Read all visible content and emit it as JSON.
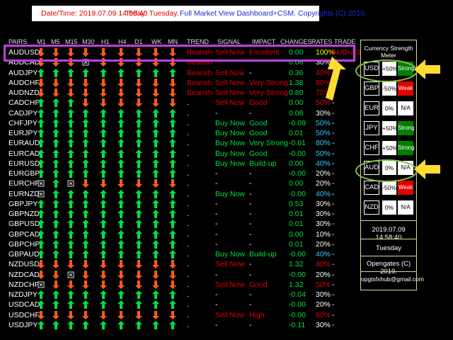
{
  "title_bar": {
    "datetime": "Date/Time:  2019.07.09 14:58:40",
    "today": "Today: Tuesday.",
    "dashboard": "Full Market View Dashboard+CSM. Copyrights (C) 2019."
  },
  "headers": [
    "PAIRS",
    "M1",
    "M5",
    "M15",
    "M30",
    "H1",
    "H4",
    "D1",
    "WK",
    "MN",
    "TREND",
    "SIGNAL",
    "IMPACT",
    "CHANGES",
    "RATES",
    "TRADE"
  ],
  "colors": {
    "up": "#00e040",
    "down": "#ff5a1a",
    "red": "#e00000",
    "green": "#00e040",
    "cyan": "#30d0ff",
    "yellow": "#ffff00",
    "white": "#ffffff",
    "strong_bg": "#008000",
    "weak_bg": "#e00000",
    "selection": "#c040e0",
    "callout_circle": "#80c040",
    "callout_arrow": "#ffdd30"
  },
  "rows": [
    {
      "pair": "AUDUSD",
      "arrows": "DDDDDDDDD",
      "trend": "Bearish",
      "signal": "Sell Now",
      "impact": "Excellent",
      "change": "0.00",
      "rate": "100%",
      "trade": "AUDUSD"
    },
    {
      "pair": "AUDCAD",
      "arrows": "DDDxDDDDD",
      "trend": "Bearish",
      "signal": "",
      "impact": "",
      "change": "0.06",
      "rate": "30%",
      "trade": "-"
    },
    {
      "pair": "AUDJPY",
      "arrows": "UUUUUUUUU",
      "trend": "Bearish",
      "signal": "Sell Now",
      "impact": "-",
      "change": "0.36",
      "rate": "40%",
      "trade": "-"
    },
    {
      "pair": "AUDCHF",
      "arrows": "DDDDDDDDD",
      "trend": "Bearish",
      "signal": "Sell Now",
      "impact": "Very Strong",
      "change": "1.38",
      "rate": "80%",
      "trade": "-"
    },
    {
      "pair": "AUDNZD",
      "arrows": "DDDDDDDDD",
      "trend": "Bearish",
      "signal": "Sell Now",
      "impact": "Very Strong",
      "change": "0.80",
      "rate": "70%",
      "trade": "-"
    },
    {
      "pair": "CADCHF",
      "arrows": "UUUDDDDDD",
      "trend": ".",
      "signal": "Sell Now",
      "impact": "Good",
      "change": "0.00",
      "rate": "50%",
      "trade": "-"
    },
    {
      "pair": "CADJPY",
      "arrows": "UUUUUUUUU",
      "trend": ".",
      "signal": "-",
      "impact": "-",
      "change": "0.08",
      "rate": "30%",
      "trade": "-"
    },
    {
      "pair": "CHFJPY",
      "arrows": "UUUUUUUUU",
      "trend": ".",
      "signal": "Buy Now",
      "impact": "Good",
      "change": "-0.09",
      "rate": "50%",
      "trade": "-"
    },
    {
      "pair": "EURJPY",
      "arrows": "UUUUUUUUU",
      "trend": ".",
      "signal": "Buy Now",
      "impact": "Good",
      "change": "0.01",
      "rate": "50%",
      "trade": "-"
    },
    {
      "pair": "EURAUD",
      "arrows": "UUUUUUUUU",
      "trend": ".",
      "signal": "Buy Now",
      "impact": "Very Strong",
      "change": "-0.01",
      "rate": "80%",
      "trade": "-"
    },
    {
      "pair": "EURCAD",
      "arrows": "UUUUUUUUU",
      "trend": ".",
      "signal": "Buy Now",
      "impact": "Good",
      "change": "-0.00",
      "rate": "50%",
      "trade": "-"
    },
    {
      "pair": "EURUSD",
      "arrows": "UUUUUUUUU",
      "trend": ".",
      "signal": "Buy Now",
      "impact": "Build-up",
      "change": "0.00",
      "rate": "40%",
      "trade": "-"
    },
    {
      "pair": "EURGBP",
      "arrows": "UUUUUUUUU",
      "trend": ".",
      "signal": "-",
      "impact": "-",
      "change": "-0.00",
      "rate": "20%",
      "trade": "-"
    },
    {
      "pair": "EURCHF",
      "arrows": "xUxDDDDDD",
      "trend": ".",
      "signal": "-",
      "impact": "-",
      "change": "0.00",
      "rate": "20%",
      "trade": "-"
    },
    {
      "pair": "EURNZD",
      "arrows": "xUUUUUUUU",
      "trend": ".",
      "signal": "Buy Now",
      "impact": "-",
      "change": "-0.00",
      "rate": "40%",
      "trade": "-"
    },
    {
      "pair": "GBPJPY",
      "arrows": "UUUUUUUUU",
      "trend": ".",
      "signal": "-",
      "impact": "-",
      "change": "0.53",
      "rate": "30%",
      "trade": "-"
    },
    {
      "pair": "GBPNZD",
      "arrows": "UUUUUUUUU",
      "trend": ".",
      "signal": "-",
      "impact": "-",
      "change": "0.01",
      "rate": "30%",
      "trade": "-"
    },
    {
      "pair": "GBPUSD",
      "arrows": "UUUUUUUUU",
      "trend": ".",
      "signal": "-",
      "impact": "-",
      "change": "0.01",
      "rate": "30%",
      "trade": "-"
    },
    {
      "pair": "GBPCAD",
      "arrows": "UUUUUUUUU",
      "trend": ".",
      "signal": "-",
      "impact": "-",
      "change": "0.00",
      "rate": "10%",
      "trade": "-"
    },
    {
      "pair": "GBPCHF",
      "arrows": "UUUUUUUUU",
      "trend": ".",
      "signal": "-",
      "impact": "-",
      "change": "0.01",
      "rate": "20%",
      "trade": "-"
    },
    {
      "pair": "GBPAUD",
      "arrows": "UUUUUUUUU",
      "trend": ".",
      "signal": "Buy Now",
      "impact": "Build-up",
      "change": "-0.00",
      "rate": "40%",
      "trade": "-"
    },
    {
      "pair": "NZDUSD",
      "arrows": "DDDDDDDDD",
      "trend": ".",
      "signal": "Sell Now",
      "impact": "-",
      "change": "1.32",
      "rate": "40%",
      "trade": "-"
    },
    {
      "pair": "NZDCAD",
      "arrows": "DDxDDDDDD",
      "trend": ".",
      "signal": "-",
      "impact": "-",
      "change": "-0.00",
      "rate": "20%",
      "trade": "-"
    },
    {
      "pair": "NZDCHF",
      "arrows": "xDDDDDDDD",
      "trend": ".",
      "signal": "Sell Now",
      "impact": "Good",
      "change": "1.32",
      "rate": "50%",
      "trade": "-"
    },
    {
      "pair": "NZDJPY",
      "arrows": "UUUUUUUUU",
      "trend": ".",
      "signal": "-",
      "impact": "-",
      "change": "-0.04",
      "rate": "30%",
      "trade": "-"
    },
    {
      "pair": "USDCAD",
      "arrows": "UUUUUUUUU",
      "trend": ".",
      "signal": "-",
      "impact": "-",
      "change": "-0.00",
      "rate": "20%",
      "trade": "-"
    },
    {
      "pair": "USDCHF",
      "arrows": "DDDDDDDDD",
      "trend": ".",
      "signal": "Sell Now",
      "impact": "High",
      "change": "-0.00",
      "rate": "60%",
      "trade": "-"
    },
    {
      "pair": "USDJPY",
      "arrows": "UUUUUUUUU",
      "trend": ".",
      "signal": "-",
      "impact": "-",
      "change": "-0.11",
      "rate": "30%",
      "trade": "-"
    }
  ],
  "meter": {
    "title": "Currency Strength Meter",
    "currencies": [
      {
        "code": "USD",
        "pct": "+50%",
        "status": "Strong"
      },
      {
        "code": "GBP",
        "pct": "-50%",
        "status": "Weak"
      },
      {
        "code": "EUR",
        "pct": "0%",
        "status": "N/A"
      },
      {
        "code": "JPY",
        "pct": "+50%",
        "status": "Strong"
      },
      {
        "code": "CHF",
        "pct": "+50%",
        "status": "Strong"
      },
      {
        "code": "AUD",
        "pct": "0%",
        "status": "N/A"
      },
      {
        "code": "CAD",
        "pct": "-50%",
        "status": "Weak"
      },
      {
        "code": "NZD",
        "pct": "0%",
        "status": "N/A"
      }
    ],
    "datetime": "2019.07.09 14:58:40",
    "day": "Tuesday",
    "copyright": "Opengates (C) 2019.",
    "email": "opgtsfxhub@gmail.com"
  }
}
